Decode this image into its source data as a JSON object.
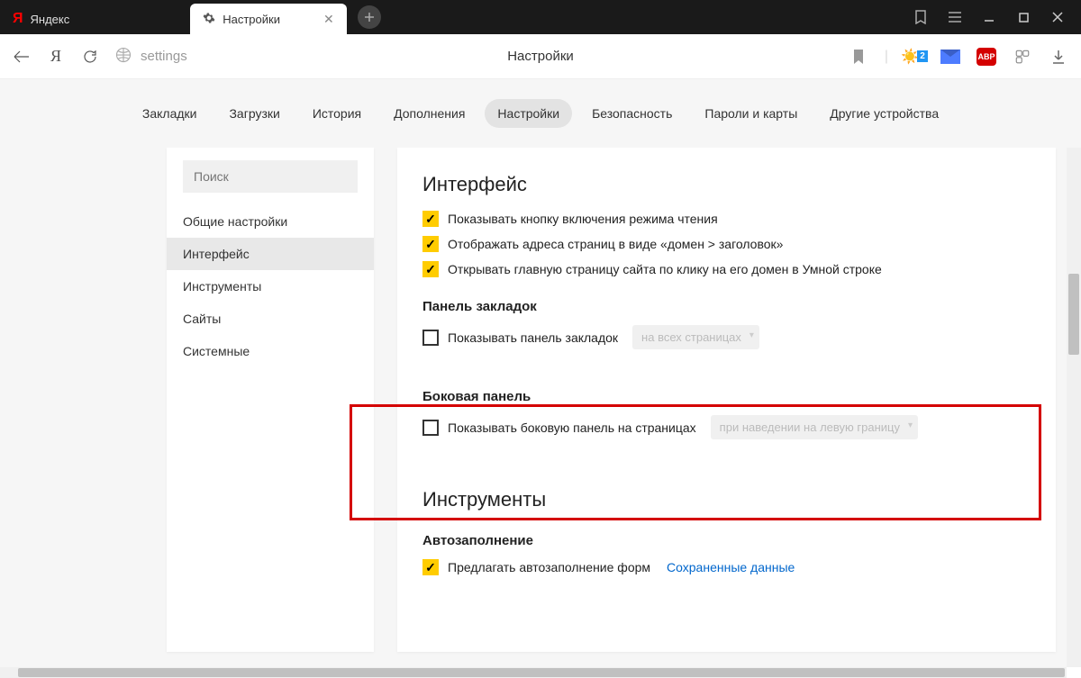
{
  "titlebar": {
    "tab1": {
      "label": "Яндекс"
    },
    "tab2": {
      "label": "Настройки"
    }
  },
  "addrbar": {
    "url": "settings",
    "title": "Настройки",
    "weather_badge": "2",
    "abp_label": "ABP"
  },
  "topnav": {
    "items": [
      "Закладки",
      "Загрузки",
      "История",
      "Дополнения",
      "Настройки",
      "Безопасность",
      "Пароли и карты",
      "Другие устройства"
    ],
    "active_index": 4
  },
  "sidebar": {
    "search_placeholder": "Поиск",
    "items": [
      "Общие настройки",
      "Интерфейс",
      "Инструменты",
      "Сайты",
      "Системные"
    ],
    "active_index": 1
  },
  "main": {
    "section1_title": "Интерфейс",
    "check1": "Показывать кнопку включения режима чтения",
    "check2": "Отображать адреса страниц в виде «домен > заголовок»",
    "check3": "Открывать главную страницу сайта по клику на его домен в Умной строке",
    "sub1": "Панель закладок",
    "check4": "Показывать панель закладок",
    "select1": "на всех страницах",
    "sub2": "Боковая панель",
    "check5": "Показывать боковую панель на страницах",
    "select2": "при наведении на левую границу",
    "section2_title": "Инструменты",
    "sub3": "Автозаполнение",
    "check6": "Предлагать автозаполнение форм",
    "link1": "Сохраненные данные"
  }
}
